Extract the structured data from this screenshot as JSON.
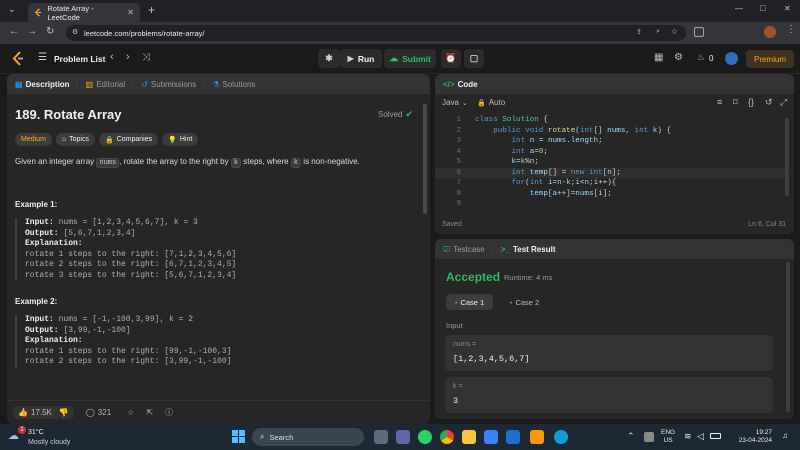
{
  "browser": {
    "tab_title": "Rotate Array - LeetCode",
    "new_tab": "+",
    "url": "leetcode.com/problems/rotate-array/",
    "window_controls": [
      "—",
      "□",
      "✕"
    ]
  },
  "nav": {
    "problem_list": "Problem List",
    "run": "Run",
    "submit": "Submit",
    "streak_count": "0",
    "premium": "Premium"
  },
  "left_tabs": [
    {
      "label": "Description",
      "icon": "description-icon"
    },
    {
      "label": "Editorial",
      "icon": "book-icon"
    },
    {
      "label": "Submissions",
      "icon": "history-icon"
    },
    {
      "label": "Solutions",
      "icon": "flask-icon"
    }
  ],
  "problem": {
    "title": "189. Rotate Array",
    "status": "Solved",
    "difficulty": "Medium",
    "chips": [
      "Topics",
      "Companies",
      "Hint"
    ],
    "desc_1": "Given an integer array",
    "desc_code_1": "nums",
    "desc_2": ", rotate the array to the right by",
    "desc_code_2": "k",
    "desc_3": "steps, where",
    "desc_code_3": "k",
    "desc_4": "is non-negative.",
    "examples": [
      {
        "heading": "Example 1:",
        "input_label": "Input:",
        "input": "nums = [1,2,3,4,5,6,7], k = 3",
        "output_label": "Output:",
        "output": "[5,6,7,1,2,3,4]",
        "explanation_label": "Explanation:",
        "lines": [
          "rotate 1 steps to the right: [7,1,2,3,4,5,6]",
          "rotate 2 steps to the right: [6,7,1,2,3,4,5]",
          "rotate 3 steps to the right: [5,6,7,1,2,3,4]"
        ]
      },
      {
        "heading": "Example 2:",
        "input_label": "Input:",
        "input": "nums = [-1,-100,3,99], k = 2",
        "output_label": "Output:",
        "output": "[3,99,-1,-100]",
        "explanation_label": "Explanation:",
        "lines": [
          "rotate 1 steps to the right: [99,-1,-100,3]",
          "rotate 2 steps to the right: [3,99,-1,-100]"
        ]
      }
    ]
  },
  "footer": {
    "likes": "17.5K",
    "comments": "321"
  },
  "code_panel": {
    "title": "Code",
    "language": "Java",
    "mode": "Auto",
    "saved": "Saved",
    "cursor": "Ln 6, Col 31"
  },
  "code_lines": [
    [
      "1",
      [
        [
          "kw",
          "class "
        ],
        [
          "ty",
          "Solution "
        ],
        [
          "pl",
          "{"
        ]
      ]
    ],
    [
      "2",
      [
        [
          "pl",
          "    "
        ],
        [
          "kw",
          "public void "
        ],
        [
          "fn",
          "rotate"
        ],
        [
          "pl",
          "("
        ],
        [
          "kw",
          "int"
        ],
        [
          "pl",
          "[] "
        ],
        [
          "vr",
          "nums"
        ],
        [
          "pl",
          ", "
        ],
        [
          "kw",
          "int "
        ],
        [
          "vr",
          "k"
        ],
        [
          "pl",
          ") {"
        ]
      ]
    ],
    [
      "3",
      [
        [
          "pl",
          "        "
        ],
        [
          "kw",
          "int "
        ],
        [
          "vr",
          "n"
        ],
        [
          "pl",
          " = "
        ],
        [
          "vr",
          "nums"
        ],
        [
          "pl",
          "."
        ],
        [
          "vr",
          "length"
        ],
        [
          "pl",
          ";"
        ]
      ]
    ],
    [
      "4",
      [
        [
          "pl",
          "        "
        ],
        [
          "kw",
          "int "
        ],
        [
          "vr",
          "a"
        ],
        [
          "pl",
          "="
        ],
        [
          "nm",
          "0"
        ],
        [
          "pl",
          ";"
        ]
      ]
    ],
    [
      "5",
      [
        [
          "pl",
          "        "
        ],
        [
          "vr",
          "k"
        ],
        [
          "pl",
          "="
        ],
        [
          "vr",
          "k"
        ],
        [
          "pl",
          "%"
        ],
        [
          "vr",
          "n"
        ],
        [
          "pl",
          ";"
        ]
      ]
    ],
    [
      "6",
      [
        [
          "pl",
          "        "
        ],
        [
          "kw",
          "int "
        ],
        [
          "vr",
          "temp"
        ],
        [
          "pl",
          "[] = "
        ],
        [
          "kw",
          "new int"
        ],
        [
          "pl",
          "["
        ],
        [
          "vr",
          "n"
        ],
        [
          "pl",
          "];"
        ]
      ]
    ],
    [
      "7",
      [
        [
          "pl",
          "        "
        ],
        [
          "kw",
          "for"
        ],
        [
          "pl",
          "("
        ],
        [
          "kw",
          "int "
        ],
        [
          "vr",
          "i"
        ],
        [
          "pl",
          "="
        ],
        [
          "vr",
          "n"
        ],
        [
          "pl",
          "-"
        ],
        [
          "vr",
          "k"
        ],
        [
          "pl",
          ";"
        ],
        [
          "vr",
          "i"
        ],
        [
          "pl",
          "<"
        ],
        [
          "vr",
          "n"
        ],
        [
          "pl",
          ";"
        ],
        [
          "vr",
          "i"
        ],
        [
          "pl",
          "++){"
        ]
      ]
    ],
    [
      "8",
      [
        [
          "pl",
          "            "
        ],
        [
          "vr",
          "temp"
        ],
        [
          "pl",
          "["
        ],
        [
          "vr",
          "a"
        ],
        [
          "pl",
          "++]="
        ],
        [
          "vr",
          "nums"
        ],
        [
          "pl",
          "["
        ],
        [
          "vr",
          "i"
        ],
        [
          "pl",
          "];"
        ]
      ]
    ],
    [
      "9",
      []
    ]
  ],
  "test_panel": {
    "tab_testcase": "Testcase",
    "tab_result": "Test Result",
    "verdict": "Accepted",
    "runtime": "Runtime: 4 ms",
    "cases": [
      "Case 1",
      "Case 2"
    ],
    "input_heading": "Input",
    "inputs": [
      {
        "label": "nums =",
        "value": "[1,2,3,4,5,6,7]"
      },
      {
        "label": "k =",
        "value": "3"
      }
    ]
  },
  "taskbar": {
    "temp": "31°C",
    "weather": "Mostly cloudy",
    "weather_badge": "1",
    "search": "Search",
    "lang_1": "ENG",
    "lang_2": "US",
    "time": "19:27",
    "date": "23-04-2024"
  },
  "colors": {
    "accent_green": "#2cbb5d",
    "medium": "#ffb800",
    "premium": "#ffa116"
  }
}
